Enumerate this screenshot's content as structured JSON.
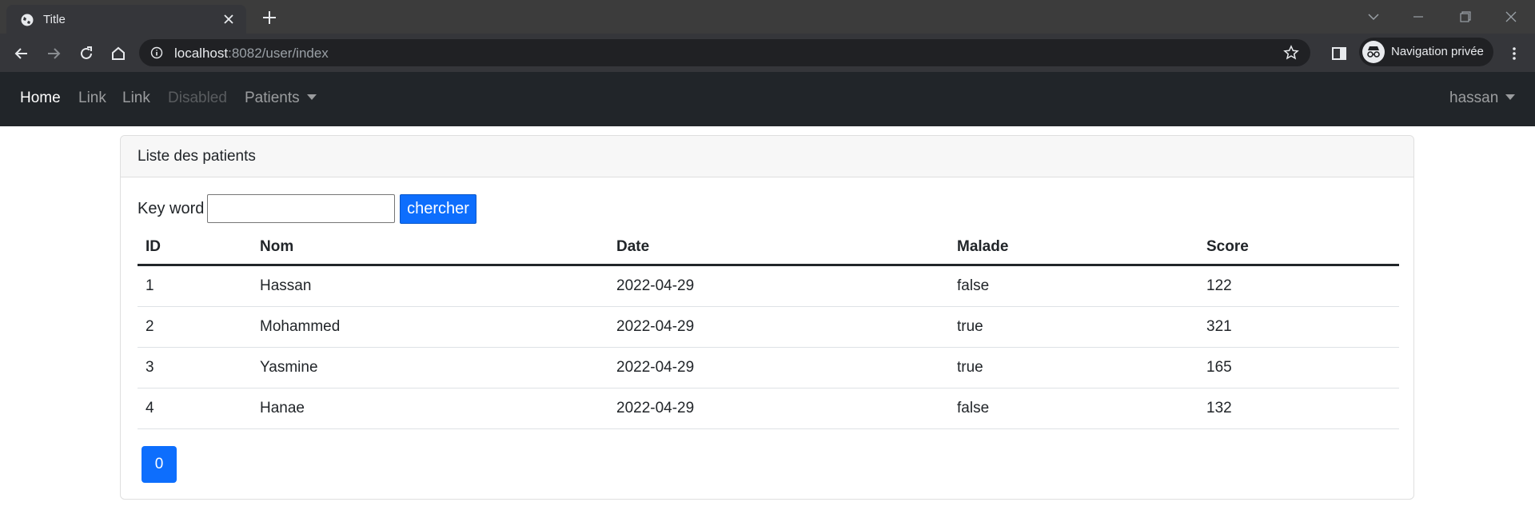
{
  "browser": {
    "tab_title": "Title",
    "url_host": "localhost",
    "url_rest": ":8082/user/index",
    "profile_label": "Navigation privée"
  },
  "navbar": {
    "items": [
      {
        "label": "Home",
        "state": "active"
      },
      {
        "label": "Link",
        "state": "normal"
      },
      {
        "label": "Link",
        "state": "normal"
      },
      {
        "label": "Disabled",
        "state": "disabled"
      },
      {
        "label": "Patients",
        "state": "dropdown"
      }
    ],
    "user": "hassan"
  },
  "card": {
    "title": "Liste des patients",
    "search": {
      "label": "Key word",
      "value": "",
      "button": "chercher"
    },
    "table": {
      "headers": [
        "ID",
        "Nom",
        "Date",
        "Malade",
        "Score"
      ],
      "rows": [
        [
          "1",
          "Hassan",
          "2022-04-29",
          "false",
          "122"
        ],
        [
          "2",
          "Mohammed",
          "2022-04-29",
          "true",
          "321"
        ],
        [
          "3",
          "Yasmine",
          "2022-04-29",
          "true",
          "165"
        ],
        [
          "4",
          "Hanae",
          "2022-04-29",
          "false",
          "132"
        ]
      ]
    },
    "pagination": [
      "0"
    ]
  },
  "colors": {
    "primary": "#0d6efd",
    "navbar_bg": "#212529",
    "chrome_bg": "#3c3c3c"
  }
}
